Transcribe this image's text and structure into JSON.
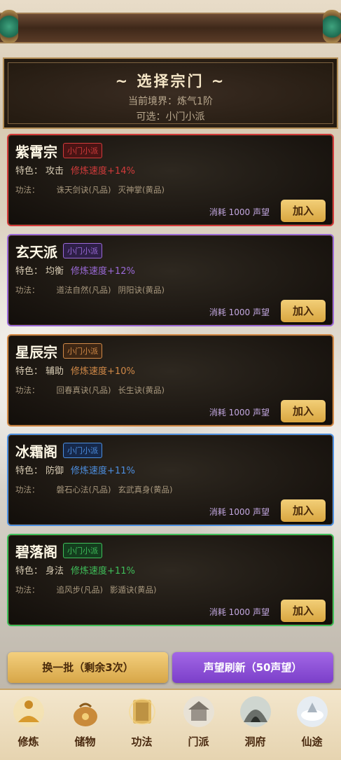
{
  "header": {
    "title": "~ 选择宗门 ~",
    "realm": "当前境界：炼气1阶",
    "available": "可选：小门小派"
  },
  "sects": [
    {
      "name": "紫霄宗",
      "tag": "小门小派",
      "trait_label": "特色：",
      "trait": "攻击",
      "speed": "修炼速度+14%",
      "tech_label": "功法：",
      "techs": [
        "诛天剑诀(凡品)",
        "灭神掌(黄品)"
      ],
      "cost": "消耗 1000 声望",
      "join": "加入",
      "accent": "#d23b3b",
      "tag_bg": "#4a1414"
    },
    {
      "name": "玄天派",
      "tag": "小门小派",
      "trait_label": "特色：",
      "trait": "均衡",
      "speed": "修炼速度+12%",
      "tech_label": "功法：",
      "techs": [
        "道法自然(凡品)",
        "阴阳诀(黄品)"
      ],
      "cost": "消耗 1000 声望",
      "join": "加入",
      "accent": "#9b6ad8",
      "tag_bg": "#2e1f47"
    },
    {
      "name": "星辰宗",
      "tag": "小门小派",
      "trait_label": "特色：",
      "trait": "辅助",
      "speed": "修炼速度+10%",
      "tech_label": "功法：",
      "techs": [
        "回春真诀(凡品)",
        "长生诀(黄品)"
      ],
      "cost": "消耗 1000 声望",
      "join": "加入",
      "accent": "#d28a48",
      "tag_bg": "#3d2614"
    },
    {
      "name": "冰霜阁",
      "tag": "小门小派",
      "trait_label": "特色：",
      "trait": "防御",
      "speed": "修炼速度+11%",
      "tech_label": "功法：",
      "techs": [
        "磐石心法(凡品)",
        "玄武真身(黄品)"
      ],
      "cost": "消耗 1000 声望",
      "join": "加入",
      "accent": "#4d8fe0",
      "tag_bg": "#16284a"
    },
    {
      "name": "碧落阁",
      "tag": "小门小派",
      "trait_label": "特色：",
      "trait": "身法",
      "speed": "修炼速度+11%",
      "tech_label": "功法：",
      "techs": [
        "追风步(凡品)",
        "影遁诀(黄品)"
      ],
      "cost": "消耗 1000 声望",
      "join": "加入",
      "accent": "#3fbf5a",
      "tag_bg": "#143d1e"
    }
  ],
  "actions": {
    "swap": "换一批（剩余3次）",
    "refresh": "声望刷新（50声望）"
  },
  "nav": [
    {
      "label": "修炼",
      "icon": "meditation-icon"
    },
    {
      "label": "储物",
      "icon": "pouch-icon"
    },
    {
      "label": "功法",
      "icon": "scroll-icon"
    },
    {
      "label": "门派",
      "icon": "temple-icon"
    },
    {
      "label": "洞府",
      "icon": "cave-icon"
    },
    {
      "label": "仙途",
      "icon": "immortal-path-icon"
    }
  ]
}
